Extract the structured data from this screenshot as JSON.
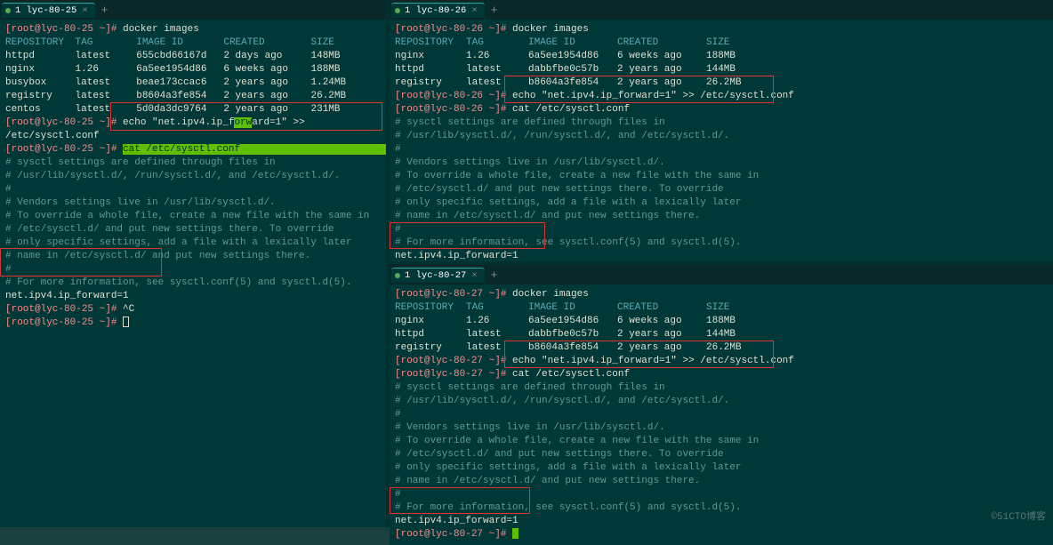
{
  "tabs": {
    "t1": "1 lyc-80-25",
    "t2": "1 lyc-80-26",
    "t3": "1 lyc-80-27"
  },
  "prompt": {
    "p25": "[root@lyc-80-25 ~]#",
    "p26": "[root@lyc-80-26 ~]#",
    "p27": "[root@lyc-80-27 ~]#"
  },
  "cmd": {
    "images": "docker images",
    "echo": "echo \"net.ipv4.ip_forward=1\" >> /etc/sysctl.conf",
    "cat": "cat /etc/sysctl.conf",
    "ctrlc": "^C"
  },
  "headers": {
    "c1": "REPOSITORY",
    "c2": "TAG",
    "c3": "IMAGE ID",
    "c4": "CREATED",
    "c5": "SIZE"
  },
  "img25": [
    {
      "c1": "httpd",
      "c2": "latest",
      "c3": "655cbd66167d",
      "c4": "2 days ago",
      "c5": "148MB"
    },
    {
      "c1": "nginx",
      "c2": "1.26",
      "c3": "6a5ee1954d86",
      "c4": "6 weeks ago",
      "c5": "188MB"
    },
    {
      "c1": "busybox",
      "c2": "latest",
      "c3": "beae173ccac6",
      "c4": "2 years ago",
      "c5": "1.24MB"
    },
    {
      "c1": "registry",
      "c2": "latest",
      "c3": "b8604a3fe854",
      "c4": "2 years ago",
      "c5": "26.2MB"
    },
    {
      "c1": "centos",
      "c2": "latest",
      "c3": "5d0da3dc9764",
      "c4": "2 years ago",
      "c5": "231MB"
    }
  ],
  "img26": [
    {
      "c1": "nginx",
      "c2": "1.26",
      "c3": "6a5ee1954d86",
      "c4": "6 weeks ago",
      "c5": "188MB"
    },
    {
      "c1": "httpd",
      "c2": "latest",
      "c3": "dabbfbe0c57b",
      "c4": "2 years ago",
      "c5": "144MB"
    },
    {
      "c1": "registry",
      "c2": "latest",
      "c3": "b8604a3fe854",
      "c4": "2 years ago",
      "c5": "26.2MB"
    }
  ],
  "img27": [
    {
      "c1": "nginx",
      "c2": "1.26",
      "c3": "6a5ee1954d86",
      "c4": "6 weeks ago",
      "c5": "188MB"
    },
    {
      "c1": "httpd",
      "c2": "latest",
      "c3": "dabbfbe0c57b",
      "c4": "2 years ago",
      "c5": "144MB"
    },
    {
      "c1": "registry",
      "c2": "latest",
      "c3": "b8604a3fe854",
      "c4": "2 years ago",
      "c5": "26.2MB"
    }
  ],
  "sysctl": {
    "l1": "# sysctl settings are defined through files in",
    "l2": "# /usr/lib/sysctl.d/, /run/sysctl.d/, and /etc/sysctl.d/.",
    "l3": "#",
    "l4": "# Vendors settings live in /usr/lib/sysctl.d/.",
    "l5": "# To override a whole file, create a new file with the same in",
    "l6": "# /etc/sysctl.d/ and put new settings there. To override",
    "l7": "# only specific settings, add a file with a lexically later",
    "l8": "# name in /etc/sysctl.d/ and put new settings there.",
    "l9": "#",
    "l10": "# For more information, see sysctl.conf(5) and sysctl.d(5).",
    "fwd": "net.ipv4.ip_forward=1"
  },
  "echo_split": {
    "a": "echo \"net.ipv4.ip_f",
    "mid": "orw",
    "b": "ard=1\" >> /etc/sysctl.conf"
  },
  "wm": "©51CTO博客"
}
